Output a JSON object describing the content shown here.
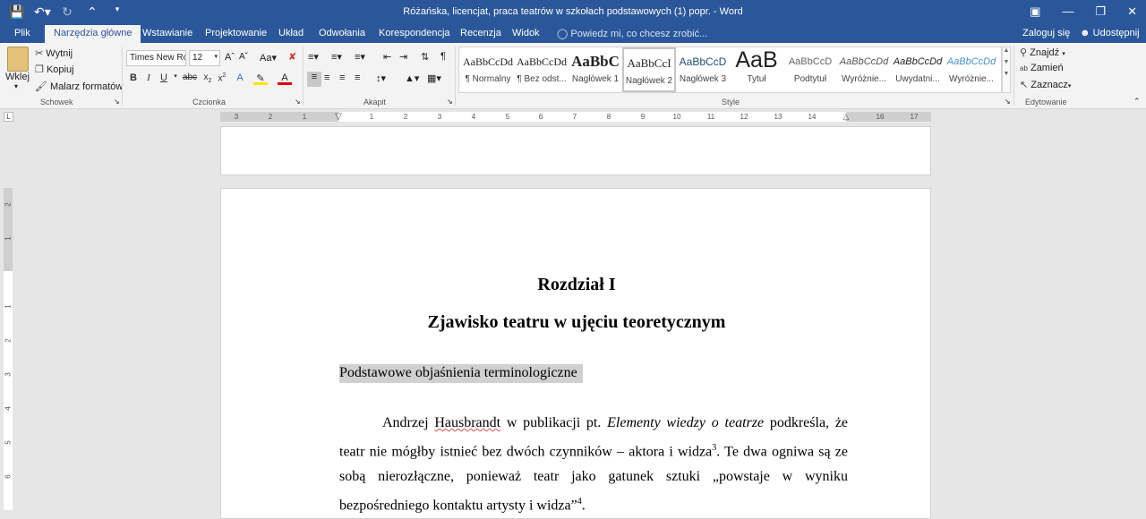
{
  "window": {
    "title": "Różańska, licencjat, praca teatrów w szkołach podstawowych (1) popr. - Word"
  },
  "quick_access": {
    "save_icon": "save-icon",
    "undo_icon": "undo-icon",
    "redo_icon": "redo-icon"
  },
  "tabs": [
    {
      "label": "Plik"
    },
    {
      "label": "Narzędzia główne"
    },
    {
      "label": "Wstawianie"
    },
    {
      "label": "Projektowanie"
    },
    {
      "label": "Układ"
    },
    {
      "label": "Odwołania"
    },
    {
      "label": "Korespondencja"
    },
    {
      "label": "Recenzja"
    },
    {
      "label": "Widok"
    }
  ],
  "tell_me": "Powiedz mi, co chcesz zrobić...",
  "account": {
    "signin": "Zaloguj się",
    "share": "Udostępnij"
  },
  "clipboard": {
    "paste": "Wklej",
    "cut": "Wytnij",
    "copy": "Kopiuj",
    "format_painter": "Malarz formatów",
    "group_label": "Schowek"
  },
  "font": {
    "name": "Times New Ro",
    "size": "12",
    "group_label": "Czcionka"
  },
  "paragraph": {
    "group_label": "Akapit"
  },
  "styles": {
    "group_label": "Style",
    "items": [
      {
        "preview": "AaBbCcDd",
        "name": "¶ Normalny"
      },
      {
        "preview": "AaBbCcDd",
        "name": "¶ Bez odst..."
      },
      {
        "preview": "AaBbC",
        "name": "Nagłówek 1"
      },
      {
        "preview": "AaBbCcI",
        "name": "Nagłówek 2"
      },
      {
        "preview": "AaBbCcD",
        "name": "Nagłówek 3"
      },
      {
        "preview": "AaB",
        "name": "Tytuł"
      },
      {
        "preview": "AaBbCcD",
        "name": "Podtytuł"
      },
      {
        "preview": "AaBbCcDd",
        "name": "Wyróżnie..."
      },
      {
        "preview": "AaBbCcDd",
        "name": "Uwydatni..."
      },
      {
        "preview": "AaBbCcDd",
        "name": "Wyróżnie..."
      }
    ]
  },
  "editing": {
    "find": "Znajdź",
    "replace": "Zamień",
    "select": "Zaznacz",
    "group_label": "Edytowanie"
  },
  "ruler": {
    "h_ticks": [
      "3",
      "2",
      "1",
      "1",
      "2",
      "3",
      "4",
      "5",
      "6",
      "7",
      "8",
      "9",
      "10",
      "11",
      "12",
      "13",
      "14",
      "16",
      "17"
    ],
    "v_ticks": [
      "2",
      "1",
      "1",
      "2",
      "3",
      "4",
      "5",
      "6"
    ],
    "corner": "L"
  },
  "document": {
    "chapter": "Rozdział I",
    "chapter_title": "Zjawisko teatru w ujęciu teoretycznym",
    "section": "Podstawowe objaśnienia terminologiczne",
    "para_1": "Andrzej ",
    "para_name": "Hausbrandt",
    "para_2": " w publikacji pt. ",
    "para_book": "Elementy wiedzy o teatrze",
    "para_3": " podkreśla, że teatr nie mógłby istnieć bez dwóch czynników – aktora i widza",
    "fn_3": "3",
    "para_4": ". Te dwa ogniwa są ze sobą nierozłączne, ponieważ teatr jako gatunek sztuki „powstaje w wyniku bezpośredniego kontaktu artysty i widza”",
    "fn_4": "4",
    "para_5": "."
  }
}
